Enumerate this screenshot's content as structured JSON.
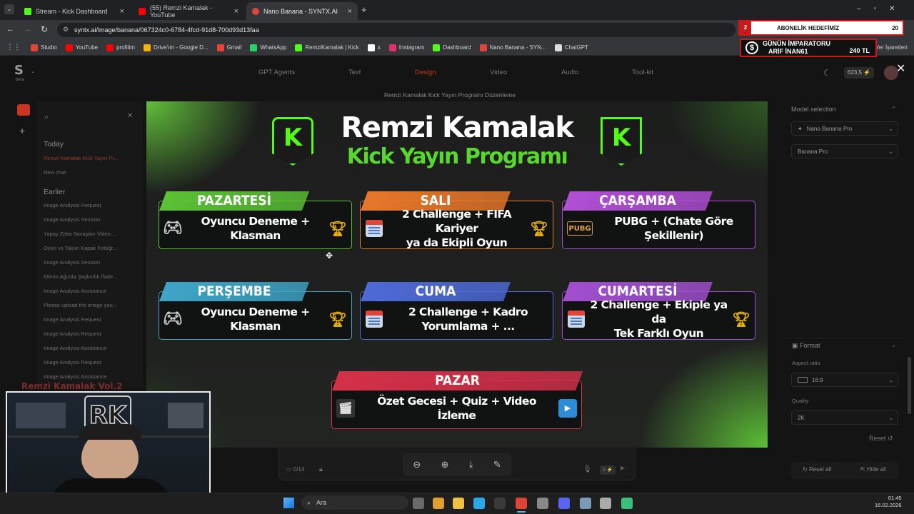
{
  "tabs": [
    {
      "label": "Stream - Kick Dashboard",
      "color": "#53fc18"
    },
    {
      "label": "(55) Remzi Kamalak - YouTube",
      "color": "#ff0000"
    },
    {
      "label": "Nano Banana - SYNTX.AI",
      "color": "#e0453a"
    }
  ],
  "tab_new": "+",
  "url": "syntx.ai/image/banana/067324c0-6784-4fcd-91d8-700d93d13faa",
  "bookmarks": [
    {
      "label": "Studio",
      "color": "#e0453a"
    },
    {
      "label": "YouTube",
      "color": "#ff0000"
    },
    {
      "label": "profilim",
      "color": "#ff0000"
    },
    {
      "label": "Drive'ım - Google D...",
      "color": "#f4b400"
    },
    {
      "label": "Gmail",
      "color": "#ea4335"
    },
    {
      "label": "WhatsApp",
      "color": "#25d366"
    },
    {
      "label": "RemziKamalak | Kick",
      "color": "#53fc18"
    },
    {
      "label": "x",
      "color": "#ffffff"
    },
    {
      "label": "Instagram",
      "color": "#e1306c"
    },
    {
      "label": "Dashboard",
      "color": "#53fc18"
    },
    {
      "label": "Nano Banana - SYN...",
      "color": "#e0453a"
    },
    {
      "label": "ChatGPT",
      "color": "#dddddd"
    }
  ],
  "bookmarks_right": "Yer İşaretleri",
  "app": {
    "logo_sub": "beta",
    "nav": [
      "GPT Agents",
      "Text",
      "Design",
      "Video",
      "Audio",
      "Tool-kit"
    ],
    "nav_active": "Design",
    "balance": "623,5 ⚡",
    "subtitle": "Remzi Kamalak Kick Yayın Programı Düzenleme"
  },
  "sidebar": {
    "today_label": "Today",
    "today_items": [
      "Remzi Kamalak Kick Yayın Pr...",
      "New chat"
    ],
    "earlier_label": "Earlier",
    "earlier_items": [
      "Image Analysis Request",
      "Image Analysis Session",
      "Yapay Zeka Savaşları Video ...",
      "Oyun ve Takım Kapak Fotoğr...",
      "Image Analysis Session",
      "Ellerin Ağızda Şaşkınlık İfade...",
      "Image Analysis Assistance",
      "Please upload the image you...",
      "Image Analysis Request",
      "Image Analysis Request",
      "Image Analysis Assistance",
      "Image Analysis Request",
      "Image Analysis Assistance"
    ]
  },
  "poster": {
    "title": "Remzi Kamalak",
    "subtitle": "Kick Yayın Programı",
    "logo_letter": "K",
    "days": [
      {
        "day": "PAZARTESİ",
        "text": "Oyuncu Deneme + Klasman",
        "color": "#5bc236",
        "icon": "gamepad-icon",
        "trophy": true
      },
      {
        "day": "SALI",
        "text": "2 Challenge + FIFA Kariyer\nya da Ekipli Oyun",
        "color": "#e8782a",
        "icon": "calendar-icon",
        "trophy": true
      },
      {
        "day": "ÇARŞAMBA",
        "text": "PUBG + (Chate Göre Şekillenir)",
        "color": "#b24fd6",
        "icon": "pubg-icon",
        "icon_text": "PUBG",
        "trophy": false
      },
      {
        "day": "PERŞEMBE",
        "text": "Oyuncu Deneme + Klasman",
        "color": "#3fa6c9",
        "icon": "gamepad-icon",
        "trophy": true
      },
      {
        "day": "CUMA",
        "text": "2 Challenge + Kadro Yorumlama + ...",
        "color": "#4e6bd8",
        "icon": "calendar-icon",
        "trophy": false
      },
      {
        "day": "CUMARTESİ",
        "text": "2 Challenge + Ekiple ya da\nTek Farklı Oyun",
        "color": "#a24fd0",
        "icon": "calendar-icon",
        "trophy": true
      },
      {
        "day": "PAZAR",
        "text": "Özet Gecesi + Quiz + Video İzleme",
        "color": "#d6304a",
        "icon": "clapper-icon",
        "trophy": false,
        "tv": true
      }
    ]
  },
  "editor": {
    "counter": "0/14",
    "send_badge": "2 ⚡"
  },
  "right_panel": {
    "model_label": "Model selection",
    "model_value": "Nano Banana Pro",
    "model_value2": "Banana Pro",
    "format_label": "Format",
    "aspect_label": "Aspect ratio",
    "aspect_value": "16:9",
    "quality_label": "Quality",
    "quality_value": "2K",
    "reset_label": "Reset",
    "reset_all": "Reset all",
    "hide_all": "Hide all"
  },
  "overlay": {
    "goal_count": "2",
    "goal_label": "ABONELİK HEDEFİMİZ",
    "goal_target": "20",
    "emperor_title": "GÜNÜN İMPARATORU",
    "emperor_name": "ARİF İNAN61",
    "emperor_amount": "240 TL",
    "cam_banner": "Remzi Kamalak Vol.2",
    "cam_logo": "RK"
  },
  "taskbar": {
    "search": "Ara",
    "time": "01:45",
    "date": "16.02.2026"
  }
}
